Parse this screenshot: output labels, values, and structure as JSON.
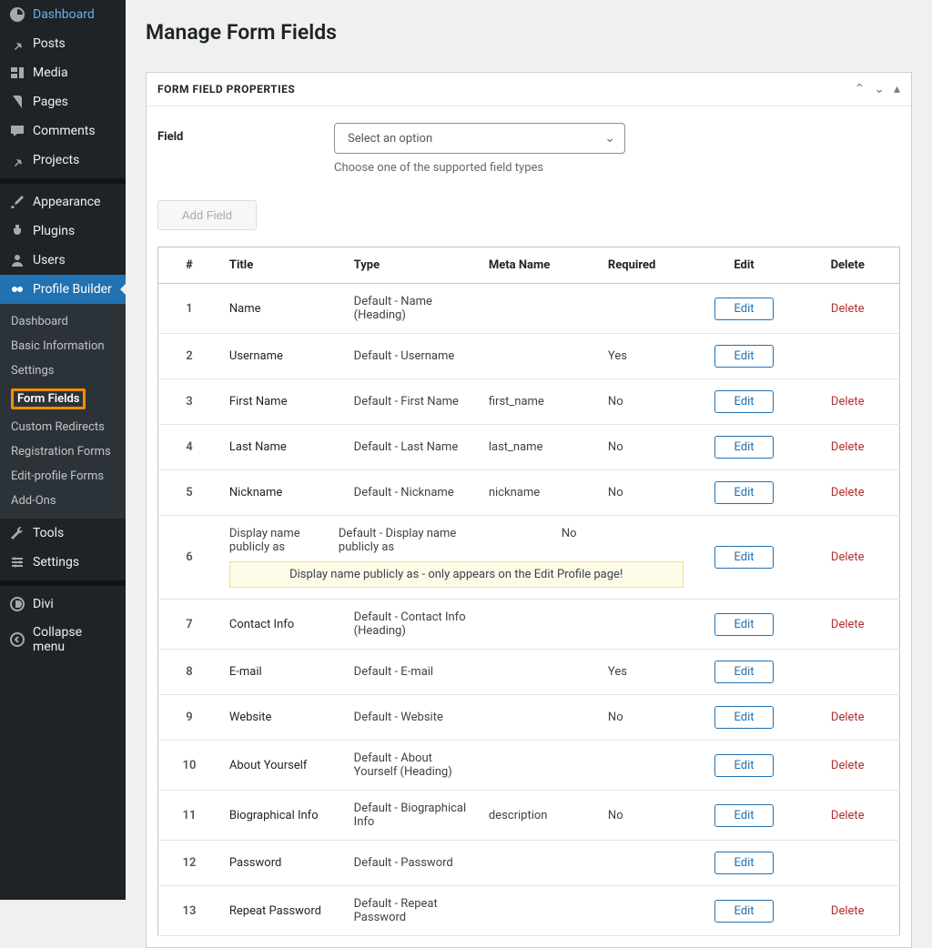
{
  "sidebar": {
    "items": [
      {
        "label": "Dashboard",
        "icon": "dashboard"
      },
      {
        "label": "Posts",
        "icon": "pin"
      },
      {
        "label": "Media",
        "icon": "media"
      },
      {
        "label": "Pages",
        "icon": "pages"
      },
      {
        "label": "Comments",
        "icon": "comments"
      },
      {
        "label": "Projects",
        "icon": "pin"
      }
    ],
    "items2": [
      {
        "label": "Appearance",
        "icon": "brush"
      },
      {
        "label": "Plugins",
        "icon": "plug"
      },
      {
        "label": "Users",
        "icon": "user"
      },
      {
        "label": "Profile Builder",
        "icon": "profile",
        "active": true
      }
    ],
    "submenu": [
      {
        "label": "Dashboard"
      },
      {
        "label": "Basic Information"
      },
      {
        "label": "Settings"
      },
      {
        "label": "Form Fields",
        "current": true
      },
      {
        "label": "Custom Redirects"
      },
      {
        "label": "Registration Forms"
      },
      {
        "label": "Edit-profile Forms"
      },
      {
        "label": "Add-Ons"
      }
    ],
    "items3": [
      {
        "label": "Tools",
        "icon": "tools"
      },
      {
        "label": "Settings",
        "icon": "settings"
      }
    ],
    "items4": [
      {
        "label": "Divi",
        "icon": "divi"
      },
      {
        "label": "Collapse menu",
        "icon": "collapse"
      }
    ]
  },
  "page": {
    "title": "Manage Form Fields"
  },
  "panel": {
    "title": "FORM FIELD PROPERTIES",
    "field_label": "Field",
    "select_placeholder": "Select an option",
    "help_text": "Choose one of the supported field types",
    "add_button": "Add Field"
  },
  "table": {
    "headers": {
      "num": "#",
      "title": "Title",
      "type": "Type",
      "meta": "Meta Name",
      "required": "Required",
      "edit": "Edit",
      "delete": "Delete"
    },
    "edit_label": "Edit",
    "delete_label": "Delete",
    "rows": [
      {
        "n": "1",
        "title": "Name",
        "type": "Default - Name (Heading)",
        "meta": "",
        "required": "",
        "delete": true
      },
      {
        "n": "2",
        "title": "Username",
        "type": "Default - Username",
        "meta": "",
        "required": "Yes",
        "delete": false
      },
      {
        "n": "3",
        "title": "First Name",
        "type": "Default - First Name",
        "meta": "first_name",
        "required": "No",
        "delete": true
      },
      {
        "n": "4",
        "title": "Last Name",
        "type": "Default - Last Name",
        "meta": "last_name",
        "required": "No",
        "delete": true
      },
      {
        "n": "5",
        "title": "Nickname",
        "type": "Default - Nickname",
        "meta": "nickname",
        "required": "No",
        "delete": true
      },
      {
        "n": "6",
        "title": "Display name publicly as",
        "type": "Default - Display name publicly as",
        "meta": "",
        "required": "No",
        "delete": true,
        "note": "Display name publicly as - only appears on the Edit Profile page!"
      },
      {
        "n": "7",
        "title": "Contact Info",
        "type": "Default - Contact Info (Heading)",
        "meta": "",
        "required": "",
        "delete": true
      },
      {
        "n": "8",
        "title": "E-mail",
        "type": "Default - E-mail",
        "meta": "",
        "required": "Yes",
        "delete": false
      },
      {
        "n": "9",
        "title": "Website",
        "type": "Default - Website",
        "meta": "",
        "required": "No",
        "delete": true
      },
      {
        "n": "10",
        "title": "About Yourself",
        "type": "Default - About Yourself (Heading)",
        "meta": "",
        "required": "",
        "delete": true
      },
      {
        "n": "11",
        "title": "Biographical Info",
        "type": "Default - Biographical Info",
        "meta": "description",
        "required": "No",
        "delete": true
      },
      {
        "n": "12",
        "title": "Password",
        "type": "Default - Password",
        "meta": "",
        "required": "",
        "delete": false
      },
      {
        "n": "13",
        "title": "Repeat Password",
        "type": "Default - Repeat Password",
        "meta": "",
        "required": "",
        "delete": true
      }
    ]
  }
}
